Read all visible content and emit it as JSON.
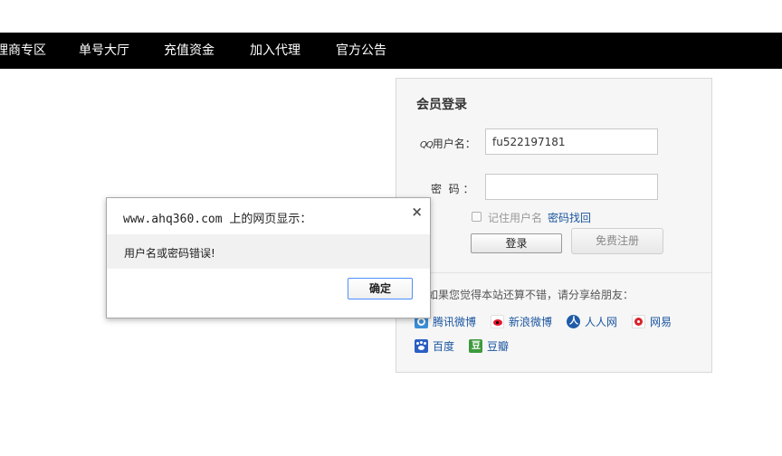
{
  "nav": {
    "items": [
      "理商专区",
      "单号大厅",
      "充值资金",
      "加入代理",
      "官方公告"
    ]
  },
  "login": {
    "title": "会员登录",
    "username_label": "用户名：",
    "qq_prefix": "QQ",
    "username_value": "fu522197181",
    "password_label": "密  码 ：",
    "password_value": "",
    "remember_label": "记住用户名",
    "find_password": "密码找回",
    "login_button": "登录",
    "register_button": "免费注册",
    "share_text": "如果您觉得本站还算不错，请分享给朋友：",
    "share_links": [
      "腾讯微博",
      "新浪微博",
      "人人网",
      "网易",
      "百度",
      "豆瓣"
    ]
  },
  "dialog": {
    "title": "www.ahq360.com 上的网页显示：",
    "close": "×",
    "message": "用户名或密码错误!",
    "ok_button": "确定"
  },
  "colors": {
    "nav_bg": "#000000",
    "link": "#1a55a0",
    "ok_border": "#4d90fe"
  }
}
